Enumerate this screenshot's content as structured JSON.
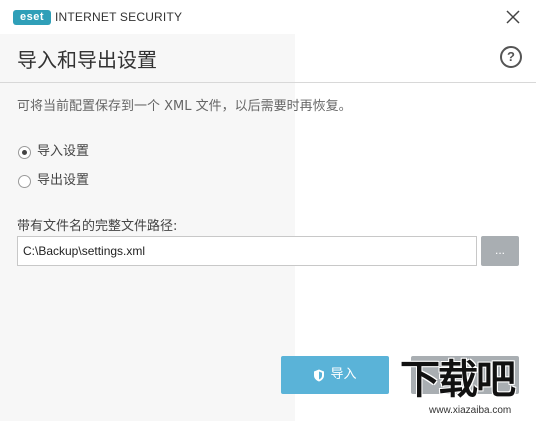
{
  "window": {
    "logo_text": "eset",
    "product_name": "INTERNET SECURITY",
    "close_icon": "close-icon"
  },
  "header": {
    "title": "导入和导出设置",
    "help_label": "?"
  },
  "description": "可将当前配置保存到一个 XML 文件，以后需要时再恢复。",
  "options": [
    {
      "label": "导入设置",
      "checked": true
    },
    {
      "label": "导出设置",
      "checked": false
    }
  ],
  "path": {
    "label": "带有文件名的完整文件路径:",
    "value": "C:\\Backup\\settings.xml",
    "browse_label": "..."
  },
  "actions": {
    "import_label": "导入",
    "import_icon": "shield-icon",
    "second_label": ""
  },
  "watermark": {
    "text": "下载吧",
    "url": "www.xiazaiba.com"
  },
  "colors": {
    "brand": "#2f9fb8",
    "primary_button": "#5ab3d8",
    "secondary_button": "#a9aeb2"
  }
}
